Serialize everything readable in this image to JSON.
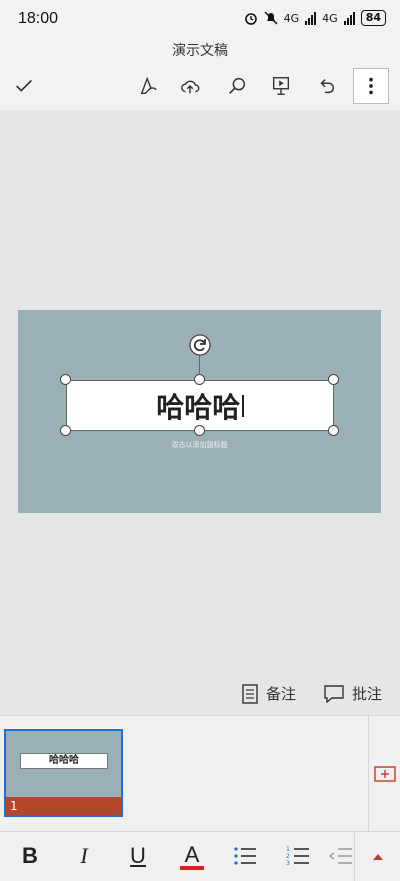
{
  "status": {
    "time": "18:00",
    "signal1_label": "4G",
    "signal2_label": "4G",
    "battery": "84"
  },
  "document": {
    "title": "演示文稿"
  },
  "toolbar": {
    "items": [
      "check-icon",
      "pen-icon",
      "cloud-upload-icon",
      "search-icon",
      "present-icon",
      "undo-icon",
      "more-icon"
    ]
  },
  "slide": {
    "title_text": "哈哈哈",
    "subtitle_placeholder": "双击以添加副标题"
  },
  "notes_bar": {
    "notes_label": "备注",
    "comments_label": "批注"
  },
  "thumbnails": [
    {
      "text": "哈哈哈",
      "number": "1"
    }
  ],
  "format_bar": {
    "bold": "B",
    "italic": "I",
    "underline": "U",
    "font_color_glyph": "A",
    "font_color": "#e01e1e"
  },
  "colors": {
    "slide_background": "#9aafb6",
    "thumbnail_accent": "#b5462a",
    "selection": "#1e6fd0"
  }
}
